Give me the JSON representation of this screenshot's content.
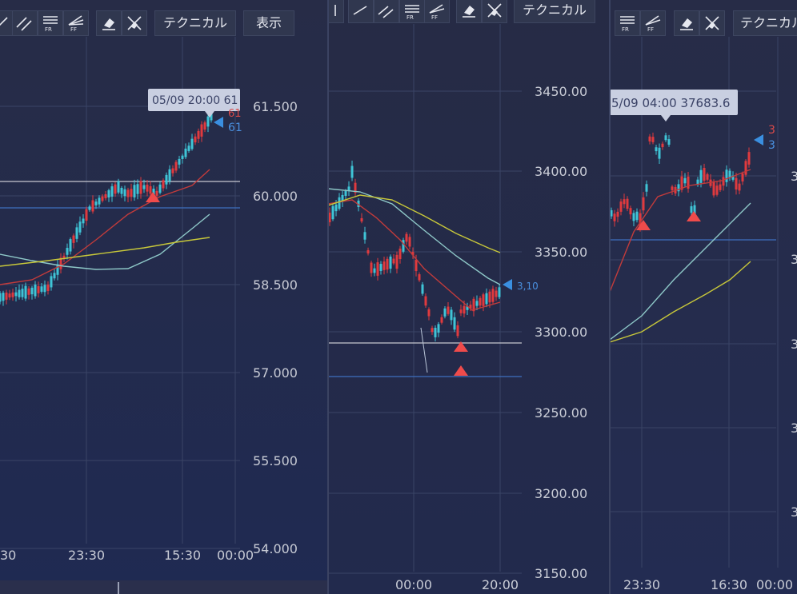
{
  "colors": {
    "bull": "#e03a3e",
    "bear": "#3fc4d6",
    "ma_short": "#c23b3b",
    "ma_mid": "#8ec8c8",
    "ma_long": "#c8c83a",
    "hline_white": "#c8c8d0",
    "hline_blue": "#3f6fbf",
    "grid": "#3a4466",
    "axis_text": "#c9ccd6",
    "marker_up": "#ef4b4b",
    "marker_price": "#3a8fe0"
  },
  "panels": [
    {
      "toolbar": {
        "icons": [
          "trend-line-icon",
          "parallel-lines-icon",
          "fib-retracement-icon",
          "fib-fan-icon",
          "eraser-icon",
          "clear-all-icon"
        ],
        "technical_label": "テクニカル",
        "display_label": "表示"
      },
      "tooltip": "05/09 20:00 61",
      "price_tags": [
        "61",
        "61"
      ],
      "y_ticks": [
        "61.500",
        "60.000",
        "58.500",
        "57.000",
        "55.500",
        "54.000"
      ],
      "x_ticks": [
        "30",
        "23:30",
        "15:30",
        "00:00"
      ]
    },
    {
      "toolbar": {
        "icons": [
          "trend-line-icon",
          "parallel-lines-icon",
          "fib-retracement-icon",
          "fib-fan-icon",
          "eraser-icon",
          "clear-all-icon"
        ],
        "technical_label": "テクニカル"
      },
      "price_tags": [
        "3,10"
      ],
      "y_ticks": [
        "3450.00",
        "3400.00",
        "3350.00",
        "3300.00",
        "3250.00",
        "3200.00",
        "3150.00"
      ],
      "x_ticks": [
        "00:00",
        "20:00"
      ]
    },
    {
      "toolbar": {
        "icons": [
          "fib-retracement-icon",
          "fib-fan-icon",
          "eraser-icon",
          "clear-all-icon"
        ],
        "technical_label": "テクニカル"
      },
      "tooltip": "5/09 04:00 37683.6",
      "price_tags": [
        "3",
        "3"
      ],
      "y_ticks": [
        "3",
        "3",
        "3",
        "3",
        "3"
      ],
      "x_ticks": [
        "23:30",
        "16:30",
        "00:00"
      ]
    }
  ]
}
